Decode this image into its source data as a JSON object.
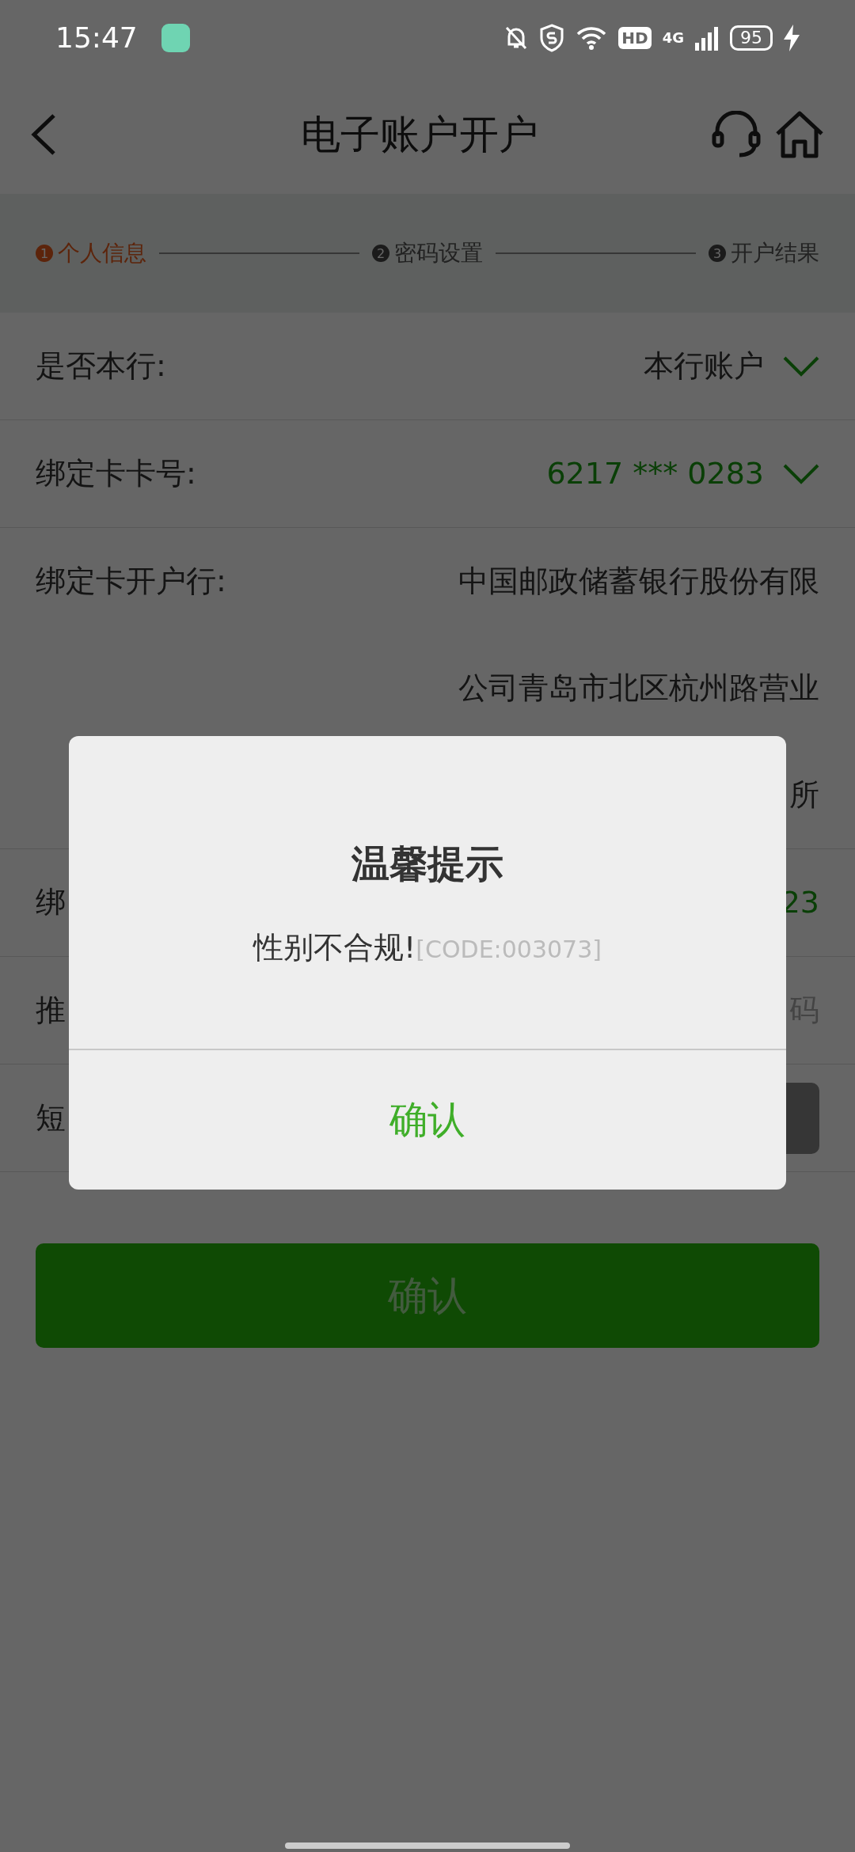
{
  "status_bar": {
    "time": "15:47",
    "hd": "HD",
    "network": "4G",
    "battery": "95"
  },
  "header": {
    "title": "电子账户开户"
  },
  "steps": [
    {
      "number": "1",
      "label": "个人信息",
      "selected": true
    },
    {
      "number": "2",
      "label": "密码设置",
      "selected": false
    },
    {
      "number": "3",
      "label": "开户结果",
      "selected": false
    }
  ],
  "form": {
    "rows": [
      {
        "kind": "select",
        "label": "是否本行:",
        "value_lines": [
          "本行账户"
        ],
        "highlighted": false
      },
      {
        "kind": "select",
        "label": "绑定卡卡号:",
        "value_lines": [
          "6217 *** 0283"
        ],
        "highlighted": true
      },
      {
        "kind": "text",
        "label": "绑定卡开户行:",
        "value_lines": [
          "中国邮政储蓄银行股份有限",
          "公司青岛市北区杭州路营业",
          "所"
        ],
        "highlighted": false
      },
      {
        "kind": "text",
        "label": "绑",
        "value_lines": [
          "23"
        ],
        "highlighted": true
      },
      {
        "kind": "input",
        "label": "推",
        "placeholder": "码"
      },
      {
        "kind": "code",
        "label": "短"
      }
    ]
  },
  "submit": {
    "label": "确认"
  },
  "dialog": {
    "title": "温馨提示",
    "message": "性别不合规!",
    "code": "[CODE:003073]",
    "button": "确认"
  }
}
